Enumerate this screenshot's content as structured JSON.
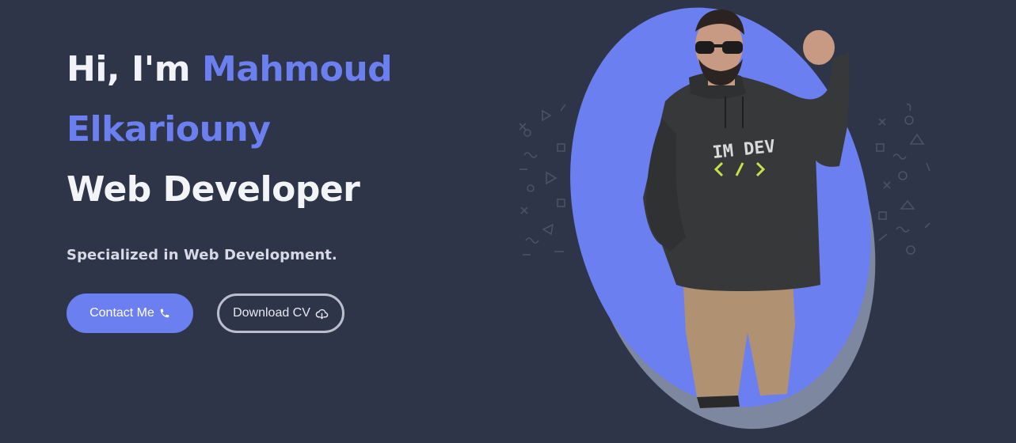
{
  "hero": {
    "greeting_prefix": "Hi, I'm ",
    "name_first": "Mahmoud",
    "name_last": "Elkariouny",
    "role": "Web Developer",
    "subtitle": "Specialized in Web Development.",
    "hoodie_text": "IM DEV"
  },
  "buttons": {
    "contact_label": "Contact Me",
    "contact_icon": "phone-icon",
    "download_label": "Download CV",
    "download_icon": "cloud-download-icon"
  },
  "colors": {
    "background": "#2e3548",
    "accent": "#6c7ff0",
    "shadow_ellipse": "#7d879f",
    "text_primary": "#f1f3f8"
  }
}
